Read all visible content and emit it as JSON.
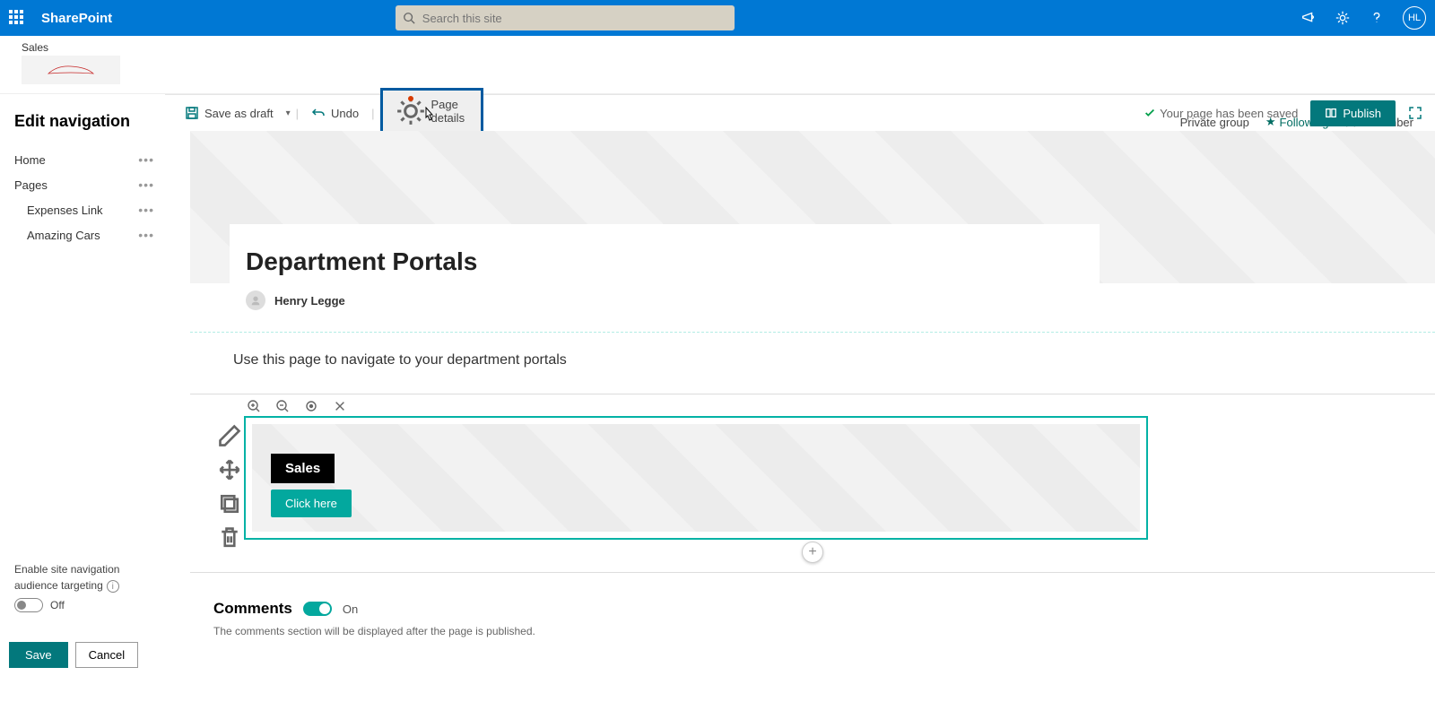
{
  "suitebar": {
    "app_name": "SharePoint",
    "search_placeholder": "Search this site",
    "avatar_initials": "HL"
  },
  "site": {
    "name": "Sales",
    "group_type": "Private group",
    "following": "Following",
    "members": "1 member"
  },
  "leftnav": {
    "title": "Edit navigation",
    "items": [
      {
        "label": "Home",
        "sub": false
      },
      {
        "label": "Pages",
        "sub": false
      },
      {
        "label": "Expenses Link",
        "sub": true
      },
      {
        "label": "Amazing Cars",
        "sub": true
      }
    ],
    "audience": {
      "line1": "Enable site navigation",
      "line2": "audience targeting",
      "off_label": "Off"
    },
    "save": "Save",
    "cancel": "Cancel"
  },
  "commandbar": {
    "save_draft": "Save as draft",
    "undo": "Undo",
    "page_details": "Page details",
    "saved_msg": "Your page has been saved",
    "publish": "Publish"
  },
  "page": {
    "title": "Department Portals",
    "author": "Henry Legge",
    "description": "Use this page to navigate to your department portals",
    "hero": {
      "label": "Sales",
      "button": "Click here"
    },
    "comments": {
      "title": "Comments",
      "state": "On",
      "note": "The comments section will be displayed after the page is published."
    }
  }
}
